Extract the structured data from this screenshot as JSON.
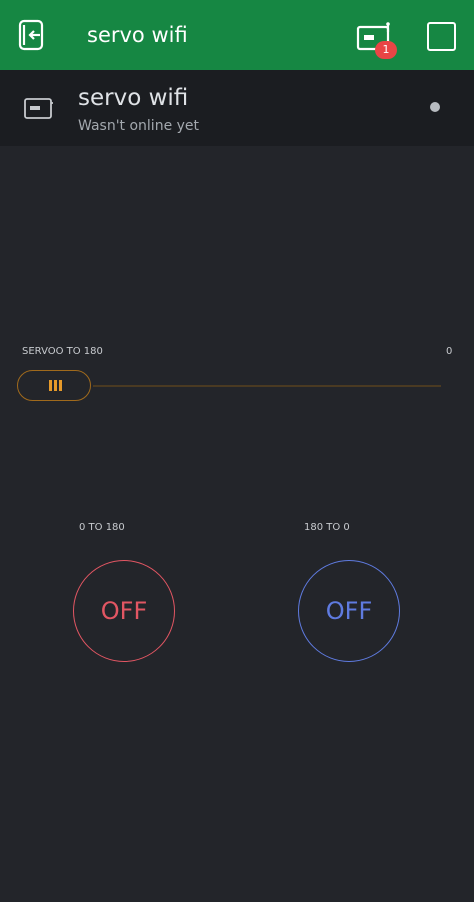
{
  "header": {
    "title": "servo wifi",
    "back_icon": "exit-icon",
    "device_icon": "device-icon",
    "notification_count": "1",
    "square_icon": "square-icon"
  },
  "device": {
    "name": "servo wifi",
    "status": "Wasn't online yet",
    "status_color": "#b8bcc1"
  },
  "slider": {
    "label": "SERVOO TO 180",
    "value": "0",
    "accent": "#e69a2a"
  },
  "buttons": [
    {
      "label": "0 TO 180",
      "state": "OFF",
      "color": "#e25663"
    },
    {
      "label": "180 TO 0",
      "state": "OFF",
      "color": "#5f7be0"
    }
  ],
  "colors": {
    "header_bg": "#168743",
    "page_bg": "#23252a",
    "panel_bg": "#1b1d21",
    "badge": "#e84545"
  }
}
